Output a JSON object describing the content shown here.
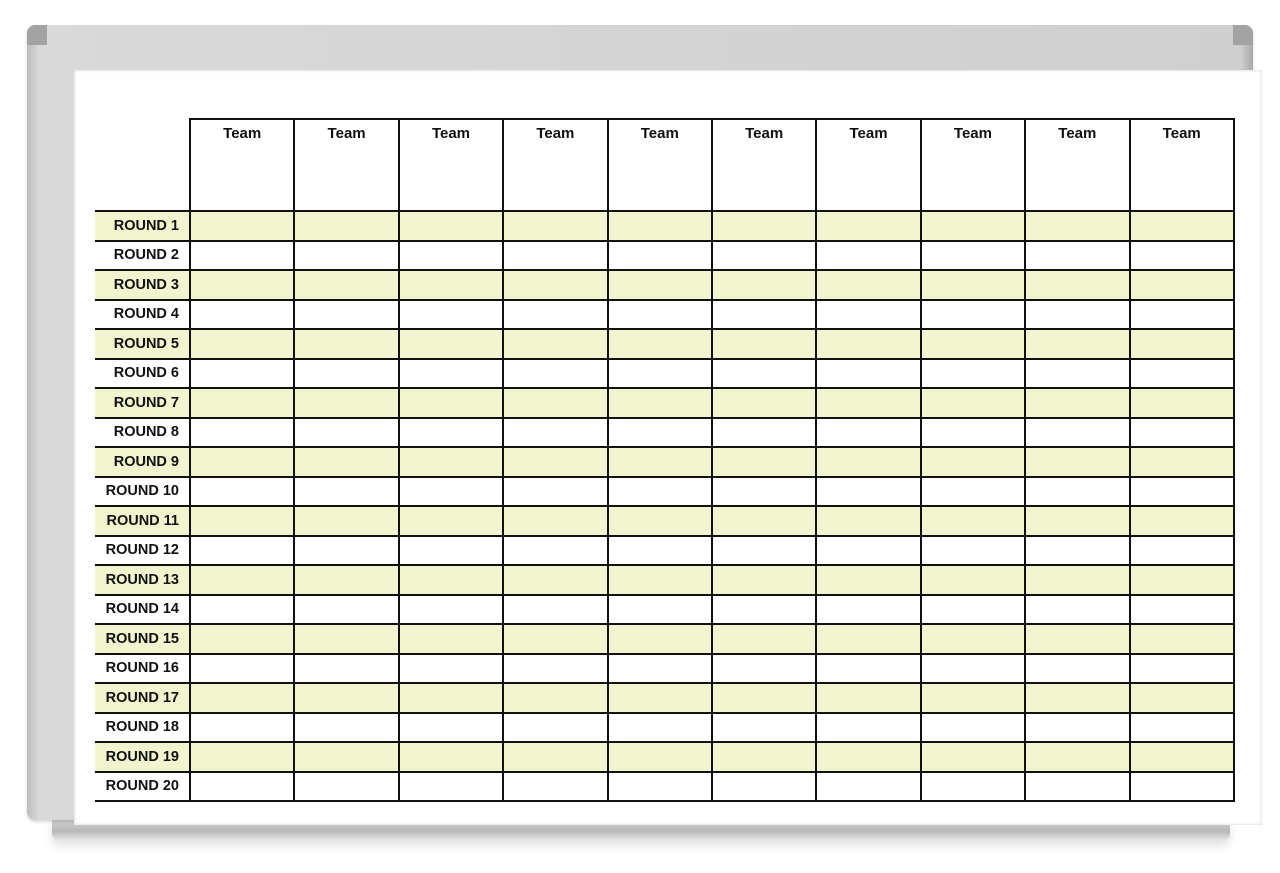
{
  "board": {
    "column_headers": [
      "Team",
      "Team",
      "Team",
      "Team",
      "Team",
      "Team",
      "Team",
      "Team",
      "Team",
      "Team"
    ],
    "rows": [
      "ROUND 1",
      "ROUND 2",
      "ROUND 3",
      "ROUND 4",
      "ROUND 5",
      "ROUND 6",
      "ROUND 7",
      "ROUND 8",
      "ROUND 9",
      "ROUND 10",
      "ROUND 11",
      "ROUND 12",
      "ROUND 13",
      "ROUND 14",
      "ROUND 15",
      "ROUND 16",
      "ROUND 17",
      "ROUND 18",
      "ROUND 19",
      "ROUND 20"
    ],
    "colors": {
      "highlight_row": "#f1f4cf",
      "frame": "#cfcfcf",
      "grid_line": "#111111"
    }
  }
}
